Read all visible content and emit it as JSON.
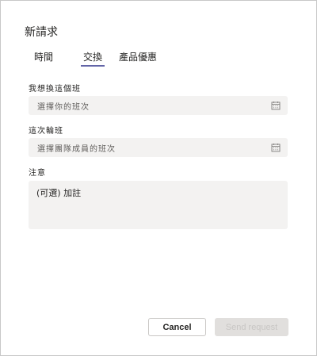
{
  "dialog": {
    "title": "新請求"
  },
  "tabs": [
    {
      "label": "時間",
      "active": false
    },
    {
      "label": "交換",
      "active": true
    },
    {
      "label": "產品優惠",
      "active": false
    }
  ],
  "form": {
    "my_shift_label": "我想換這個班",
    "my_shift_placeholder": "選擇你的班次",
    "their_shift_label": "這次輪班",
    "their_shift_placeholder": "選擇團隊成員的班次",
    "note_label": "注意",
    "note_placeholder": "(可選) 加註"
  },
  "actions": {
    "cancel_label": "Cancel",
    "send_label": "Send request"
  },
  "icons": {
    "calendar": "calendar-icon"
  },
  "colors": {
    "accent": "#6264a7",
    "field_bg": "#f3f2f1",
    "disabled_bg": "#e1dfdd"
  }
}
